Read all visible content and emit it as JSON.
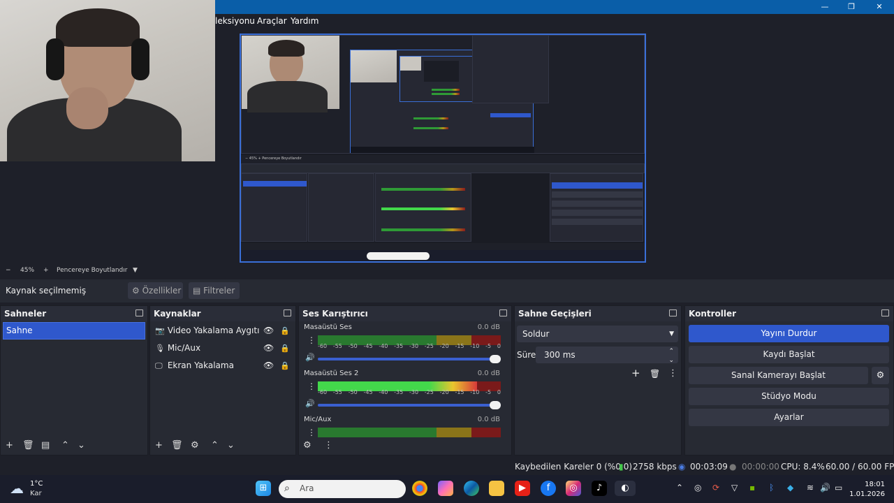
{
  "window": {
    "title_controls": [
      "—",
      "❐",
      "✕"
    ]
  },
  "menu": {
    "items": [
      "leksiyonu",
      "Araçlar",
      "Yardım"
    ]
  },
  "zoom": {
    "minus": "−",
    "value": "45%",
    "plus": "+",
    "fit_label": "Pencereye Boyutlandır"
  },
  "source_toolbar": {
    "selected": "Kaynak seçilmemiş",
    "properties": "Özellikler",
    "filters": "Filtreler"
  },
  "scenes": {
    "title": "Sahneler",
    "items": [
      "Sahne"
    ]
  },
  "sources": {
    "title": "Kaynaklar",
    "items": [
      {
        "label": "Video Yakalama Aygıtı",
        "icon": "camera-icon"
      },
      {
        "label": "Mic/Aux",
        "icon": "microphone-icon"
      },
      {
        "label": "Ekran Yakalama",
        "icon": "monitor-icon"
      }
    ]
  },
  "mixer": {
    "title": "Ses Karıştırıcı",
    "ticks": [
      "-60",
      "-55",
      "-50",
      "-45",
      "-40",
      "-35",
      "-30",
      "-25",
      "-20",
      "-15",
      "-10",
      "-5",
      "0"
    ],
    "channels": [
      {
        "name": "Masaüstü Ses",
        "db": "0.0 dB",
        "level": 0.0
      },
      {
        "name": "Masaüstü Ses 2",
        "db": "0.0 dB",
        "level": 0.87
      },
      {
        "name": "Mic/Aux",
        "db": "0.0 dB",
        "level": 0.0
      }
    ]
  },
  "transitions": {
    "title": "Sahne Geçişleri",
    "selected": "Soldur",
    "duration_label": "Süre",
    "duration_value": "300 ms"
  },
  "controls": {
    "title": "Kontroller",
    "stop_stream": "Yayını Durdur",
    "start_record": "Kaydı Başlat",
    "start_virtualcam": "Sanal Kamerayı Başlat",
    "studio_mode": "Stüdyo Modu",
    "settings": "Ayarlar"
  },
  "status": {
    "dropped_frames": "Kaybedilen Kareler 0 (%0.0)",
    "bitrate": "2758 kbps",
    "stream_time": "00:03:09",
    "record_time": "00:00:00",
    "cpu": "CPU: 8.4%",
    "fps": "60.00 / 60.00 FPS"
  },
  "taskbar": {
    "weather_temp": "1°C",
    "weather_desc": "Kar",
    "search_placeholder": "Ara",
    "time": "18:01",
    "date": "1.01.2026"
  },
  "colors": {
    "accent": "#2f58cc",
    "titlebar": "#0a5ea8",
    "panel": "#272a33",
    "background": "#1e2029"
  }
}
